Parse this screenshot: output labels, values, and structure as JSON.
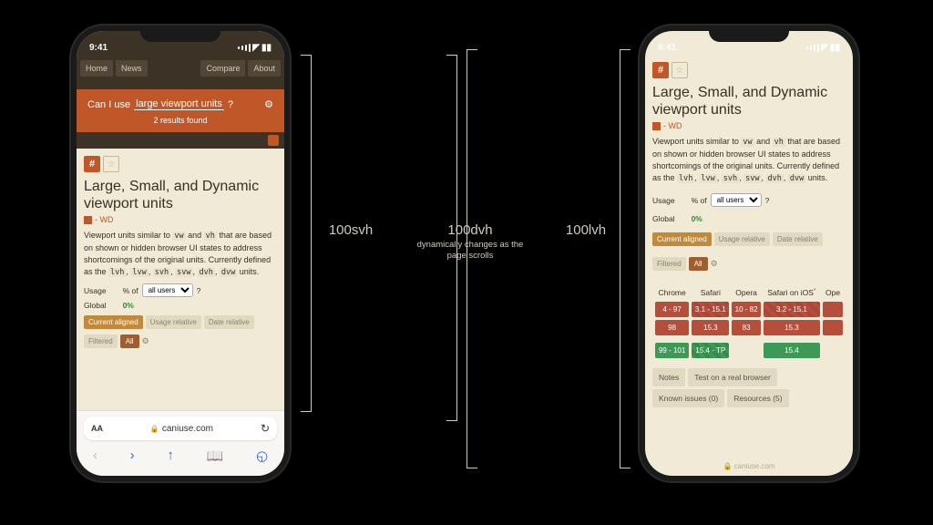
{
  "status": {
    "time": "9:41"
  },
  "nav": {
    "home": "Home",
    "news": "News",
    "compare": "Compare",
    "about": "About"
  },
  "search": {
    "prefix": "Can I use",
    "query": "large viewport units",
    "suffix": "?",
    "results": "2 results found"
  },
  "feature": {
    "title": "Large, Small, and Dynamic viewport units",
    "status": "- WD",
    "desc_pre": "Viewport units similar to ",
    "vw": "vw",
    "and": " and ",
    "vh": "vh",
    "desc_mid": " that are based on shown or hidden browser UI states to address shortcomings of the original units. Currently defined as the ",
    "u1": "lvh",
    "u2": "lvw",
    "u3": "svh",
    "u4": "svw",
    "u5": "dvh",
    "u6": "dvw",
    "desc_end": " units."
  },
  "usage": {
    "label": "Usage",
    "pctof": "% of",
    "select": "all users",
    "q": "?",
    "global": "Global",
    "pct": "0%"
  },
  "chips": {
    "current": "Current aligned",
    "urel": "Usage relative",
    "drel": "Date relative",
    "filtered": "Filtered",
    "all": "All"
  },
  "safari": {
    "domain": "caniuse.com",
    "aa": "AA"
  },
  "support": {
    "heads": [
      "Chrome",
      "Safari",
      "Opera",
      "Safari on iOS",
      "Ope"
    ],
    "rows": [
      [
        "4 - 97",
        "3.1 - 15.1",
        "10 - 82",
        "3.2 - 15.1",
        ""
      ],
      [
        "98",
        "15.3",
        "83",
        "15.3",
        ""
      ],
      [
        "99 - 101",
        "15.4 - TP",
        "",
        "15.4",
        ""
      ]
    ],
    "cls": [
      [
        "red",
        "redh",
        "red",
        "redh",
        "red"
      ],
      [
        "red",
        "red",
        "red",
        "red",
        "red"
      ],
      [
        "grn",
        "grnh",
        "",
        "grn",
        ""
      ]
    ]
  },
  "ftabs": {
    "notes": "Notes",
    "test": "Test on a real browser",
    "known": "Known issues (0)",
    "res": "Resources (5)"
  },
  "dims": {
    "svh": "100svh",
    "dvh": "100dvh",
    "dvh_sub": "dynamically changes as the page scrolls",
    "lvh": "100lvh"
  }
}
